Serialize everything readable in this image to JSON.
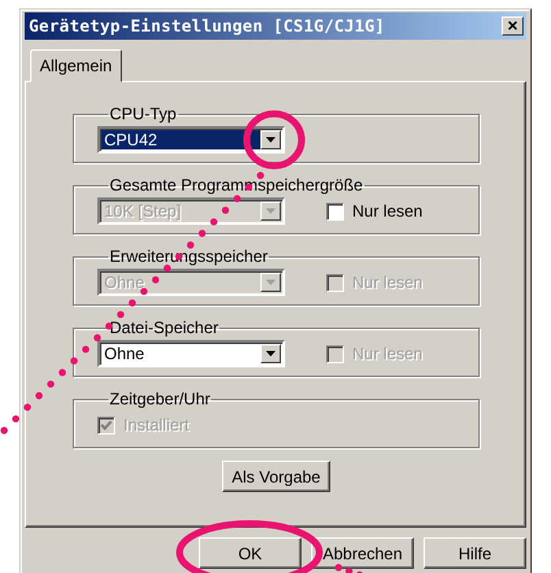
{
  "window": {
    "title": "Gerätetyp-Einstellungen [CS1G/CJ1G]",
    "close": "×"
  },
  "tabs": [
    {
      "label": "Allgemein",
      "selected": true
    }
  ],
  "groups": [
    {
      "title": "CPU-Typ",
      "combo": {
        "value": "CPU42",
        "disabled": false,
        "focused": true
      }
    },
    {
      "title": "Gesamte Programmspeichergröße",
      "combo": {
        "value": "10K [Step]",
        "disabled": true,
        "focused": false
      },
      "checkbox": {
        "label": "Nur lesen",
        "checked": false,
        "disabled": false
      }
    },
    {
      "title": "Erweiterungsspeicher",
      "combo": {
        "value": "Ohne",
        "disabled": true,
        "focused": false
      },
      "checkbox": {
        "label": "Nur lesen",
        "checked": false,
        "disabled": true
      }
    },
    {
      "title": "Datei-Speicher",
      "combo": {
        "value": "Ohne",
        "disabled": false,
        "focused": false
      },
      "checkbox": {
        "label": "Nur lesen",
        "checked": false,
        "disabled": true
      }
    },
    {
      "title": "Zeitgeber/Uhr",
      "checkbox": {
        "label": "Installiert",
        "checked": true,
        "disabled": true
      }
    }
  ],
  "default_button": "Als Vorgabe",
  "buttons": [
    {
      "label": "OK"
    },
    {
      "label": "Abbrechen"
    },
    {
      "label": "Hilfe"
    }
  ]
}
